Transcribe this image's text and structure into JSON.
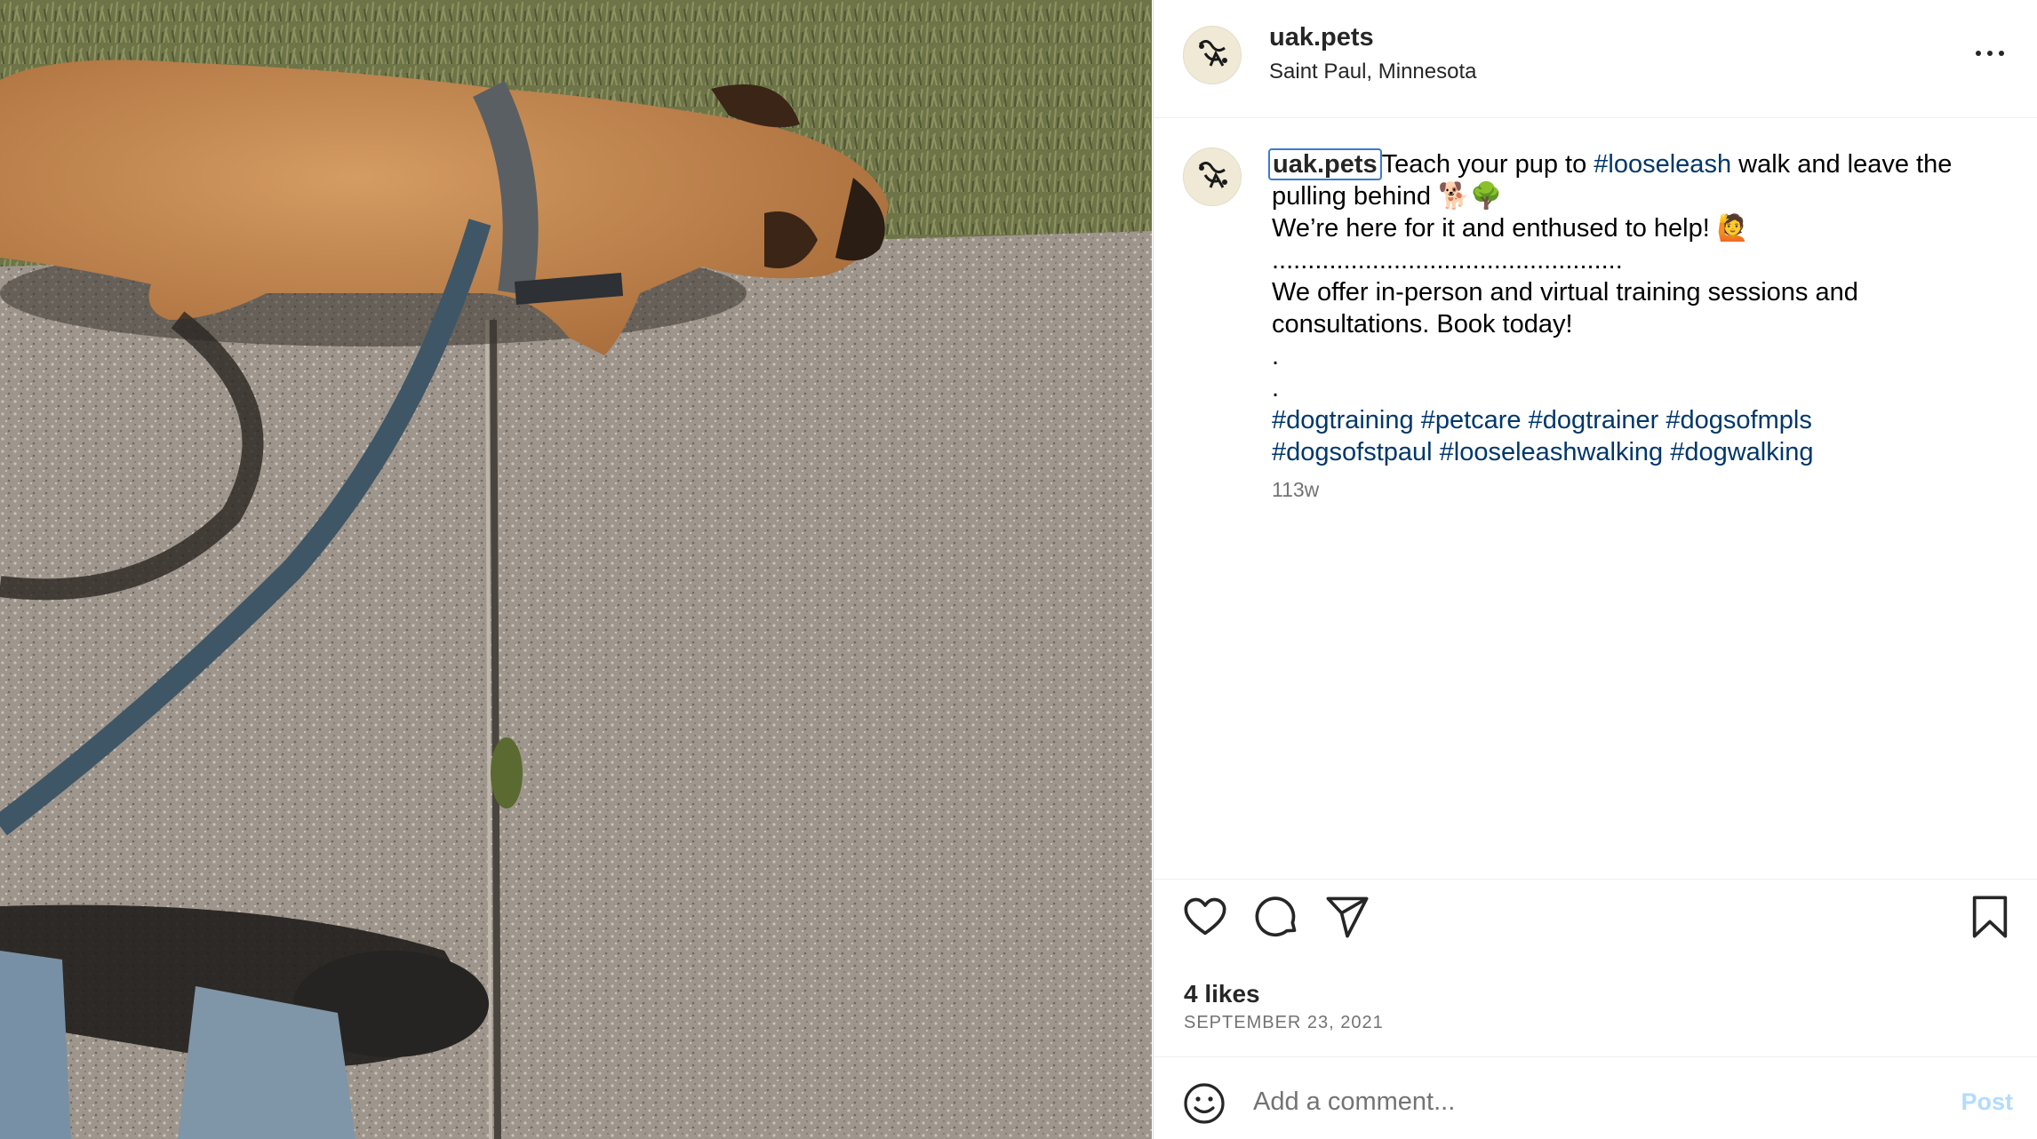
{
  "photo": {
    "alt_name": "dog-walking-photo"
  },
  "post": {
    "username": "uak.pets",
    "location": "Saint Paul, Minnesota",
    "avatar_text": "U.A.K",
    "caption": {
      "username": "uak.pets",
      "line1_before": "Teach your pup to ",
      "line1_tag": "#looseleash",
      "line1_after": " walk and leave the",
      "line2": "pulling behind 🐕🌳",
      "line3": "We’re here for it and enthused to help! 🙋",
      "line4": ".................................................",
      "line5": "We offer in-person and virtual training sessions and",
      "line6": "consultations. Book today!",
      "line7": ".",
      "line8": ".",
      "tags_line1": [
        "#dogtraining",
        "#petcare",
        "#dogtrainer",
        "#dogsofmpls"
      ],
      "tags_line2": [
        "#dogsofstpaul",
        "#looseleashwalking",
        "#dogwalking"
      ]
    },
    "age": "113w",
    "likes": "4 likes",
    "date": "SEPTEMBER 23, 2021"
  },
  "comment_box": {
    "placeholder": "Add a comment...",
    "post_label": "Post"
  },
  "colors": {
    "hashtag": "#00376b",
    "focus_ring": "#3a7bd5",
    "post_disabled": "#b3dbff",
    "muted": "#737373"
  },
  "icons": [
    "more-icon",
    "heart-icon",
    "comment-icon",
    "share-icon",
    "bookmark-icon",
    "emoji-icon"
  ]
}
